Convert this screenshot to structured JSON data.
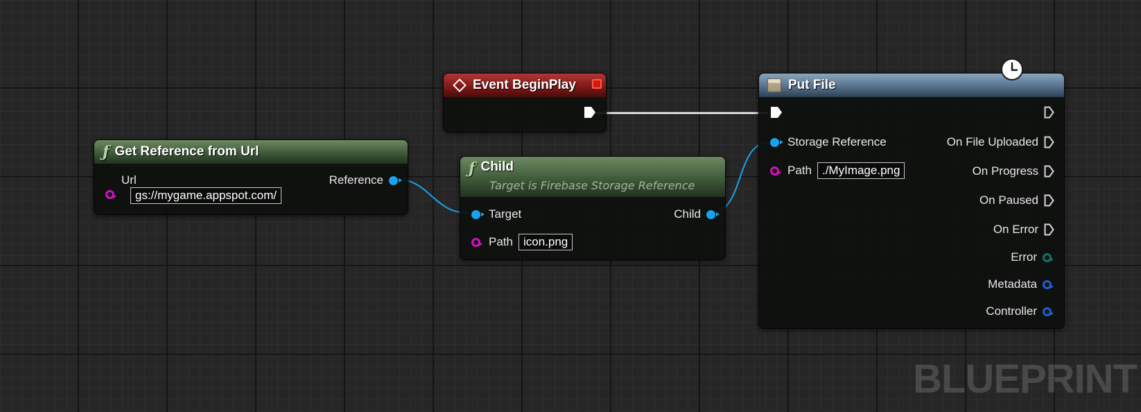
{
  "nodes": {
    "event_begin_play": {
      "title": "Event BeginPlay"
    },
    "get_reference": {
      "title": "Get Reference from Url",
      "url_label": "Url",
      "url_value": "gs://mygame.appspot.com/",
      "reference_label": "Reference"
    },
    "child": {
      "title": "Child",
      "subtitle": "Target is Firebase Storage Reference",
      "target_label": "Target",
      "child_label": "Child",
      "path_label": "Path",
      "path_value": "icon.png"
    },
    "put_file": {
      "title": "Put File",
      "storage_reference_label": "Storage Reference",
      "path_label": "Path",
      "path_value": "./MyImage.png",
      "outputs": {
        "on_file_uploaded": "On File Uploaded",
        "on_progress": "On Progress",
        "on_paused": "On Paused",
        "on_error": "On Error",
        "error": "Error",
        "metadata": "Metadata",
        "controller": "Controller"
      }
    }
  },
  "watermark": "BLUEPRINT",
  "colors": {
    "object_pin": "#1aa3ec",
    "string_pin": "#d40ec6",
    "error_pin": "#1a6e6a",
    "struct_pin": "#1e5fd6",
    "exec_wire": "#ffffff",
    "event_header": "#8b1d1c",
    "function_header": "#4d6b45",
    "latent_header": "#5b7791"
  },
  "icons": {
    "function": "function-icon",
    "event": "event-diamond-icon",
    "latent": "clock-icon",
    "macro": "macro-icon"
  }
}
